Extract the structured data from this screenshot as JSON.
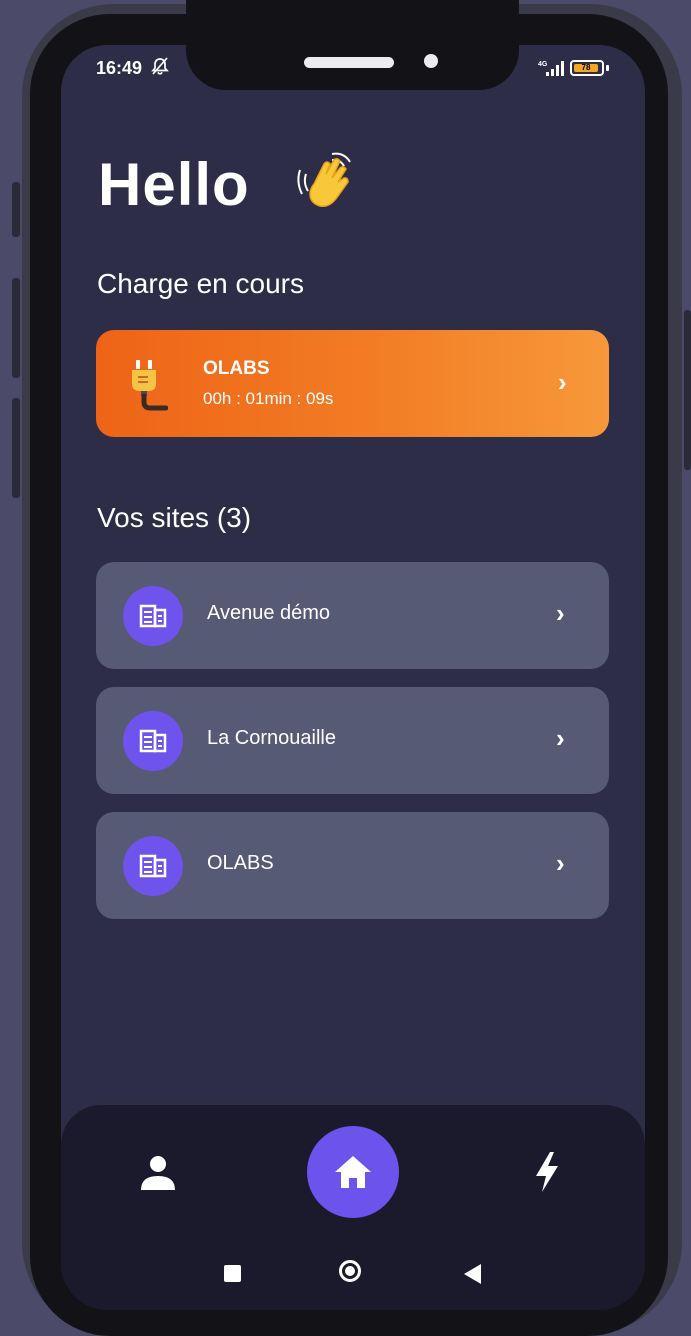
{
  "status_bar": {
    "time": "16:49",
    "network": "4G",
    "battery": "78"
  },
  "greeting": {
    "text": "Hello"
  },
  "charging": {
    "section_title": "Charge en cours",
    "station_name": "OLABS",
    "duration": "00h : 01min : 09s"
  },
  "sites": {
    "section_title": "Vos sites (3)",
    "items": [
      {
        "label": "Avenue démo"
      },
      {
        "label": "La Cornouaille"
      },
      {
        "label": "OLABS"
      }
    ]
  },
  "nav": {
    "items": [
      {
        "icon": "user-icon"
      },
      {
        "icon": "home-icon"
      },
      {
        "icon": "lightning-icon"
      }
    ]
  },
  "colors": {
    "background": "#2d2d48",
    "accent": "#6b53ec",
    "charge_card": "#f27d25",
    "site_card": "#575a74"
  }
}
